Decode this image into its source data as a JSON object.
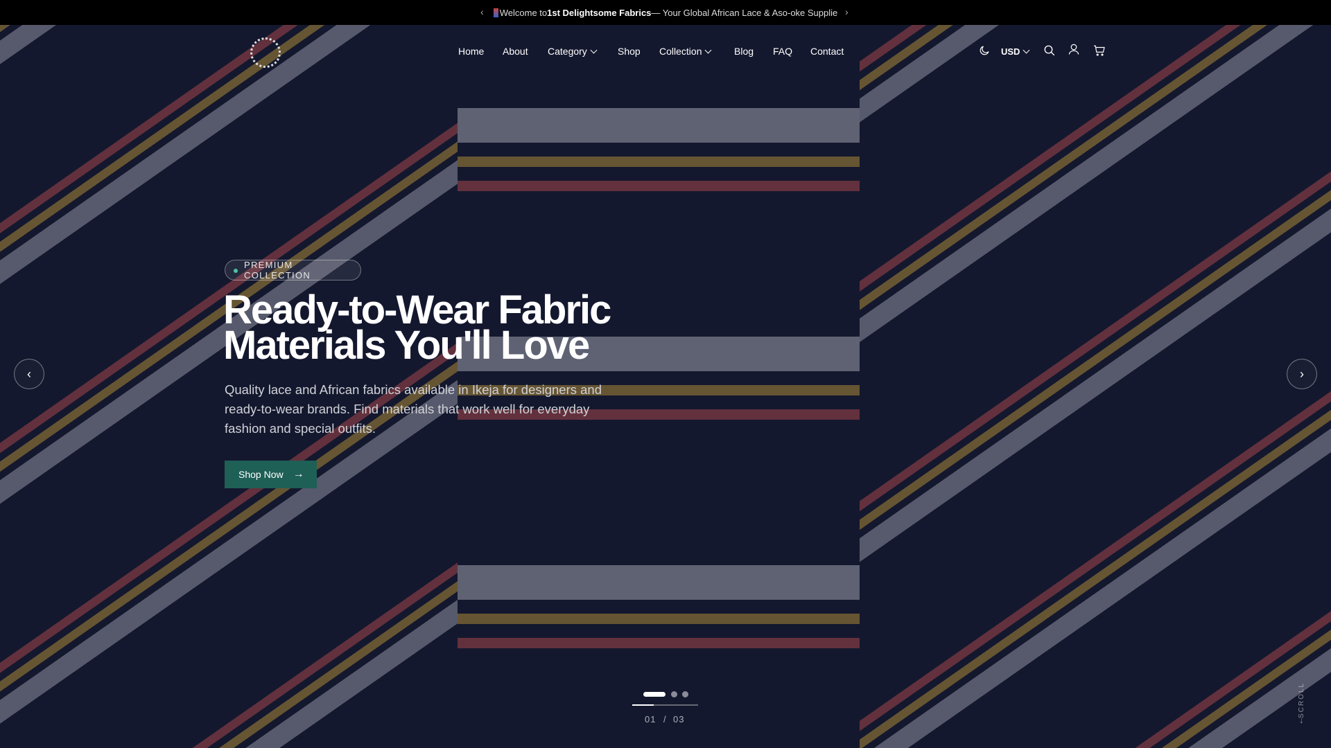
{
  "announcement": {
    "prefix": "Welcome to ",
    "brand": "1st Delightsome Fabrics",
    "suffix": " — Your Global African Lace & Aso-oke Supplie"
  },
  "logo_text": "1st Delightsome Fabrics",
  "nav": [
    {
      "label": "Home"
    },
    {
      "label": "About"
    },
    {
      "label": "Category"
    },
    {
      "label": "Shop"
    },
    {
      "label": "Collection"
    },
    {
      "label": "Blog"
    },
    {
      "label": "FAQ"
    },
    {
      "label": "Contact"
    }
  ],
  "currency": "USD",
  "hero": {
    "badge": "PREMIUM COLLECTION",
    "title_line1": "Ready-to-Wear Fabric",
    "title_line2": "Materials You'll Love",
    "subtitle": "Quality lace and African fabrics available in Ikeja for designers and ready-to-wear brands. Find materials that work well for everyday fashion and special outfits.",
    "cta": "Shop Now"
  },
  "slider": {
    "current": "01",
    "separator": "/",
    "total": "03",
    "progress": 0.33
  },
  "scroll_label": "SCROLL",
  "colors": {
    "accent": "#1e5f56",
    "badge_dot": "#4fc3a8",
    "topbar": "#000000"
  }
}
